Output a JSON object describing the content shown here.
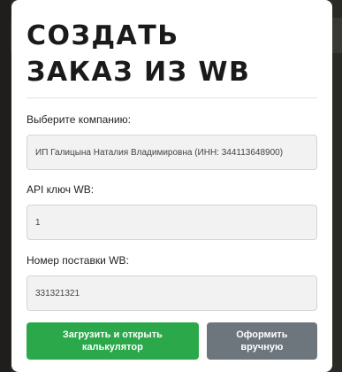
{
  "modal": {
    "title": "СОЗДАТЬ ЗАКАЗ ИЗ WB"
  },
  "form": {
    "company_label": "Выберите компанию:",
    "company_value": "ИП Галицына Наталия Владимировна (ИНН: 344113648900)",
    "api_key_label": "API ключ WB:",
    "api_key_value": "1",
    "supply_label": "Номер поставки WB:",
    "supply_value": "331321321"
  },
  "actions": {
    "primary_label": "Загрузить и открыть калькулятор",
    "secondary_label": "Оформить вручную"
  },
  "colors": {
    "primary": "#2aa84a",
    "secondary": "#6d757d"
  }
}
